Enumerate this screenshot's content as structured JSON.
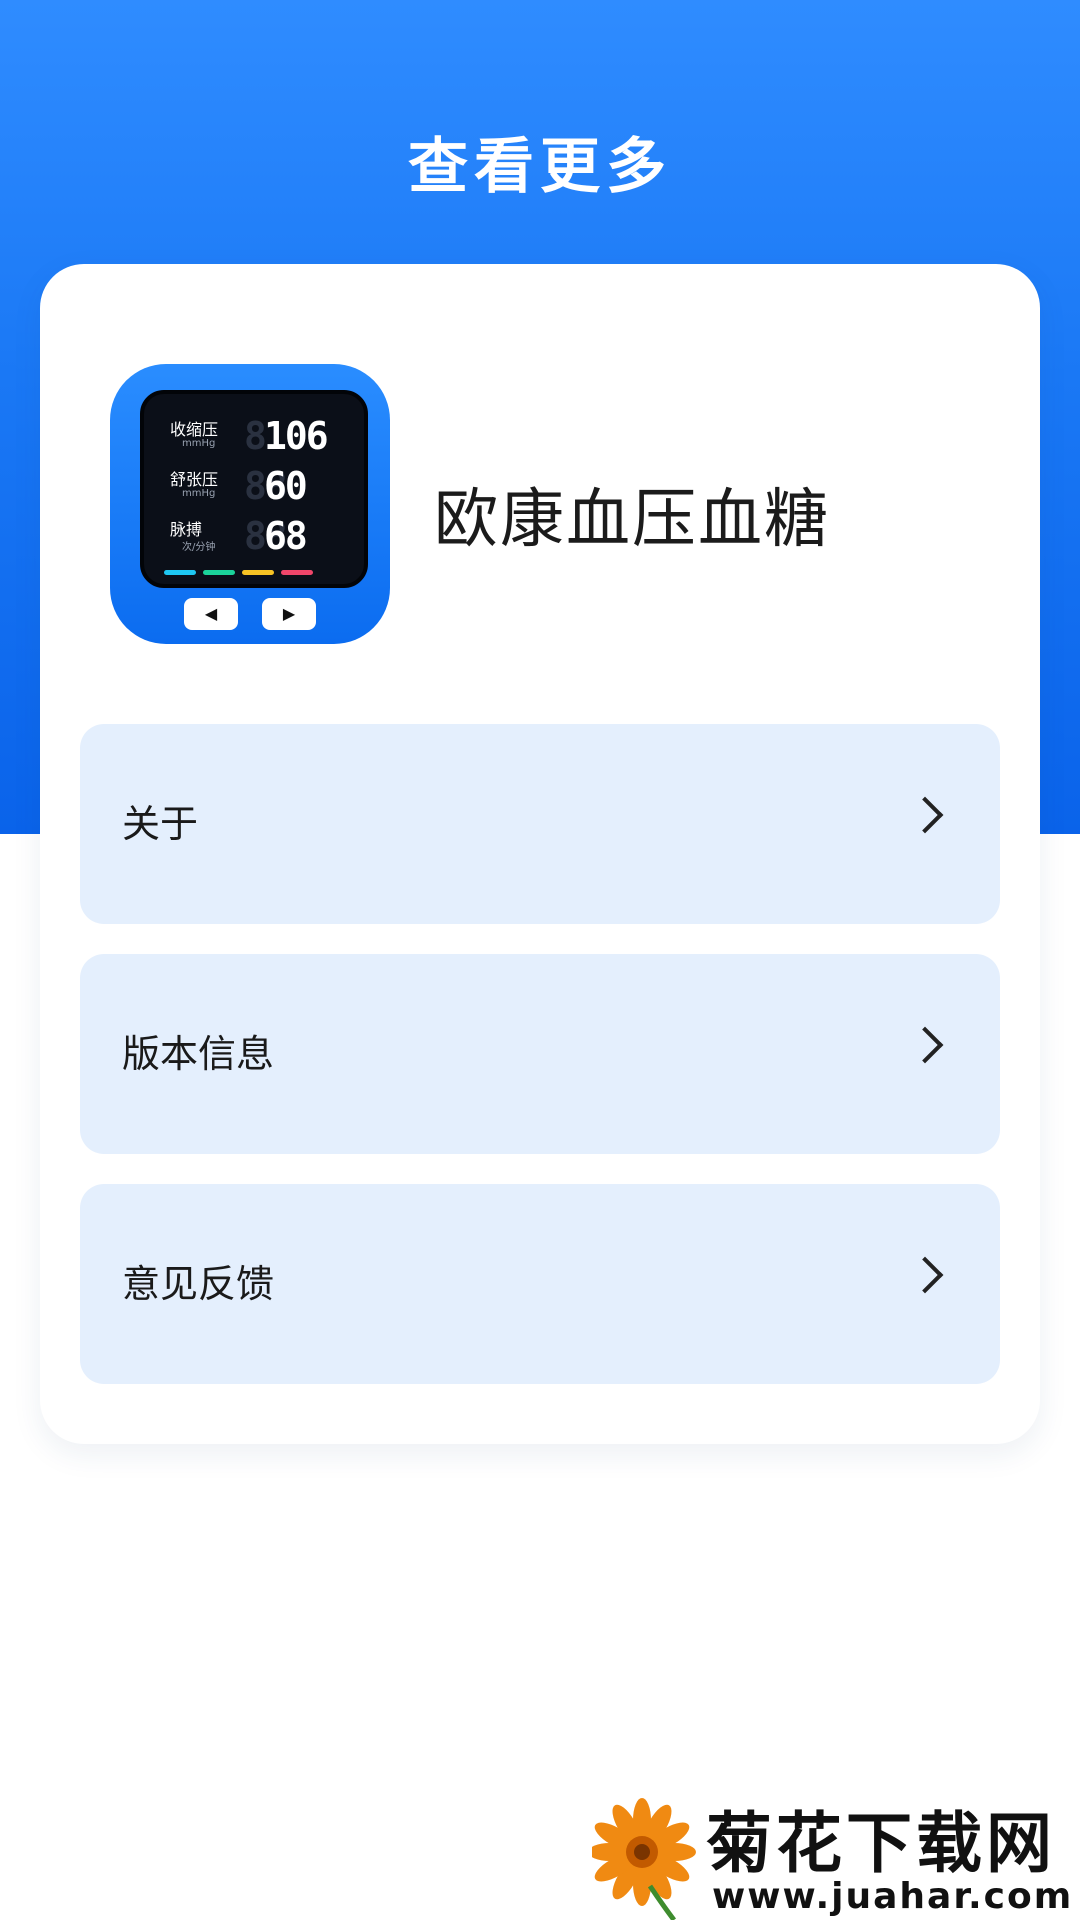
{
  "header": {
    "title": "查看更多"
  },
  "app": {
    "name": "欧康血压血糖",
    "icon": {
      "rows": [
        {
          "label": "收缩压",
          "unit": "mmHg",
          "ghost": "8",
          "value": "106"
        },
        {
          "label": "舒张压",
          "unit": "mmHg",
          "ghost": "88",
          "value": "60"
        },
        {
          "label": "脉搏",
          "unit": "次/分钟",
          "ghost": "88",
          "value": "68"
        }
      ],
      "bar_colors": [
        "#1ec7f2",
        "#1bd39a",
        "#f7c324",
        "#f0466a"
      ],
      "left_button": "◀",
      "right_button": "▶"
    }
  },
  "menu": {
    "items": [
      {
        "label": "关于"
      },
      {
        "label": "版本信息"
      },
      {
        "label": "意见反馈"
      }
    ]
  },
  "watermark": {
    "text": "菊花下载网",
    "url": "www.juahar.com"
  },
  "colors": {
    "accent": "#1a78f5",
    "item_bg": "#e4effd"
  }
}
